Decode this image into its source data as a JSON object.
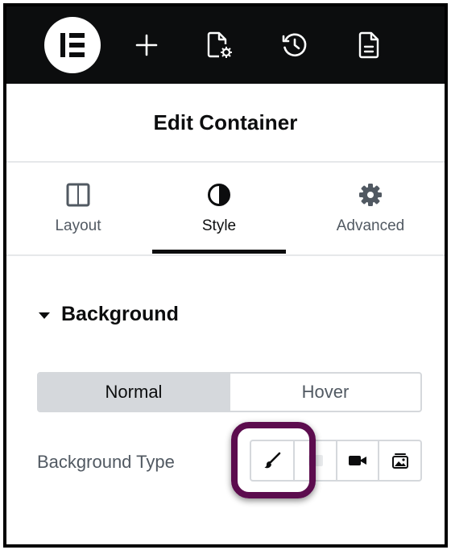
{
  "topbar": {
    "logo": "elementor-logo-icon",
    "icons": [
      "plus-icon",
      "page-settings-icon",
      "history-icon",
      "document-icon"
    ]
  },
  "header": {
    "title": "Edit Container"
  },
  "tabs": [
    {
      "label": "Layout",
      "icon": "layout-columns-icon",
      "active": false
    },
    {
      "label": "Style",
      "icon": "contrast-half-circle-icon",
      "active": true
    },
    {
      "label": "Advanced",
      "icon": "gear-icon",
      "active": false
    }
  ],
  "section": {
    "title": "Background",
    "expanded": true
  },
  "state_toggle": {
    "options": [
      "Normal",
      "Hover"
    ],
    "selected": "Normal"
  },
  "background_type": {
    "label": "Background Type",
    "options": [
      "brush-icon",
      "gradient-icon",
      "video-camera-icon",
      "slideshow-icon"
    ],
    "highlighted": "brush-icon"
  },
  "colors": {
    "topbar": "#0c0d0e",
    "highlight": "#5c0c4e",
    "selected_toggle": "#d5d8dc"
  }
}
